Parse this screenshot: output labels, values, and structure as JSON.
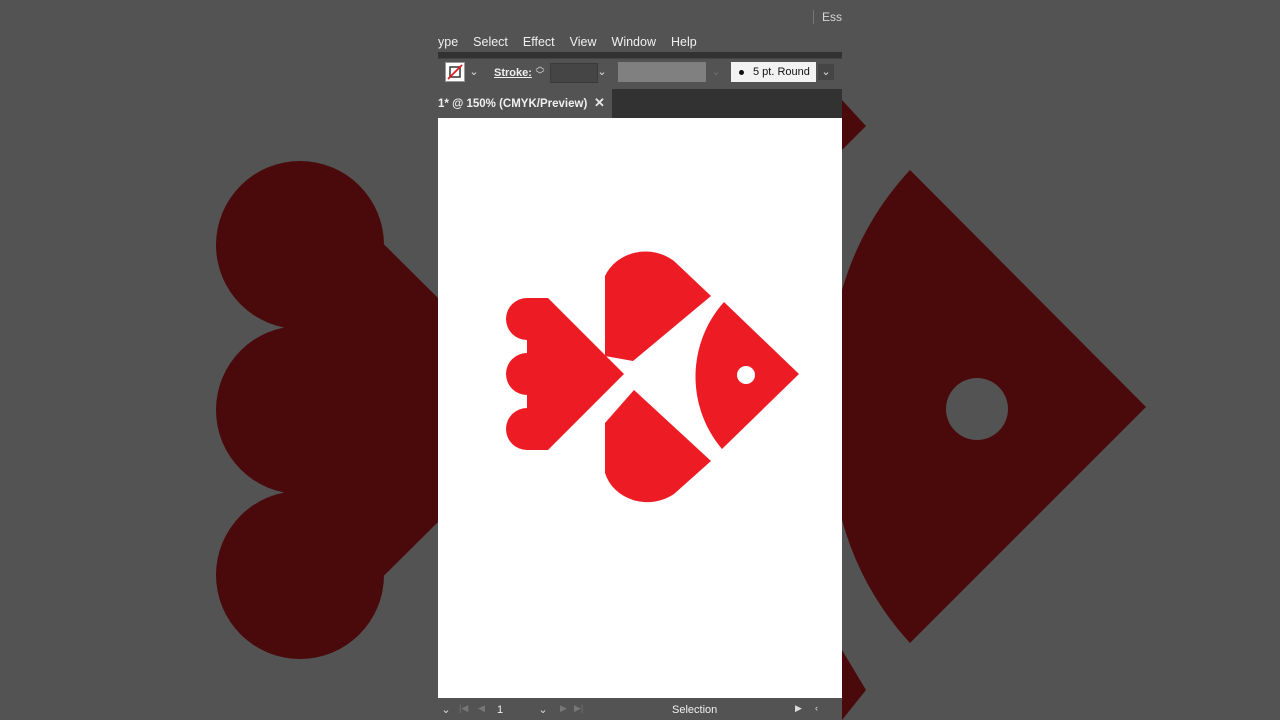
{
  "menubar": {
    "items": [
      "ype",
      "Select",
      "Effect",
      "View",
      "Window",
      "Help"
    ]
  },
  "titlebar": {
    "workspace_label": "Ess"
  },
  "controlbar": {
    "stroke_label": "Stroke:",
    "brush_definition": "5 pt. Round"
  },
  "document_tab": {
    "title": "1* @ 150% (CMYK/Preview)",
    "close_glyph": "✕"
  },
  "statusbar": {
    "page_number": "1",
    "status": "Selection"
  },
  "icons": {
    "fill_stroke_swatch": "none-stroke-swatch-icon",
    "dropdown": "chevron-down-icon",
    "close": "close-icon"
  },
  "colors": {
    "artwork_red": "#ed1c24",
    "background_artwork_red": "#4a090b",
    "canvas": "#ffffff",
    "app_panel": "#535353"
  }
}
